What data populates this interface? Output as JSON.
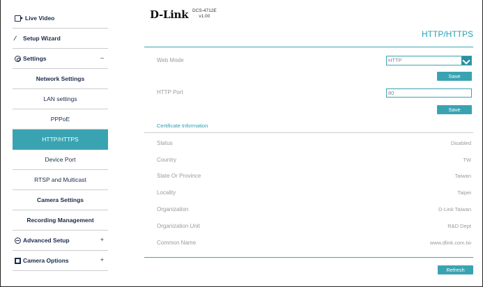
{
  "header": {
    "logo_text": "D-Link",
    "model": "DCS-4712E",
    "version": "v1.00"
  },
  "sidebar": {
    "live_video": "Live Video",
    "setup_wizard": "Setup Wizard",
    "settings": "Settings",
    "settings_sign": "–",
    "network_settings": "Network Settings",
    "lan_settings": "LAN settings",
    "pppoe": "PPPoE",
    "http_https": "HTTP/HTTPS",
    "device_port": "Device Port",
    "rtsp_multicast": "RTSP and Multicast",
    "camera_settings": "Camera Settings",
    "recording_management": "Recording Management",
    "advanced_setup": "Advanced Setup",
    "advanced_sign": "+",
    "camera_options": "Camera Options",
    "camera_options_sign": "+"
  },
  "main": {
    "title": "HTTP/HTTPS",
    "web_mode_label": "Web Mode",
    "web_mode_value": "HTTP",
    "save_label": "Save",
    "http_port_label": "HTTP Port",
    "http_port_value": "80",
    "save2_label": "Save",
    "cert_title": "Certificate Information",
    "cert_rows": [
      {
        "label": "Status",
        "value": "Disabled"
      },
      {
        "label": "Country",
        "value": "TW"
      },
      {
        "label": "State Or Province",
        "value": "Taiwan"
      },
      {
        "label": "Locality",
        "value": "Taipei"
      },
      {
        "label": "Organization",
        "value": "D-Link Taiwan"
      },
      {
        "label": "Organization Unit",
        "value": "R&D Dept"
      },
      {
        "label": "Common Name",
        "value": "www.dlink.com.tw"
      }
    ],
    "refresh_label": "Refresh"
  },
  "colors": {
    "accent": "#3aa3b2",
    "nav_text": "#1a2a4a",
    "label_text": "#9a9a9a"
  }
}
